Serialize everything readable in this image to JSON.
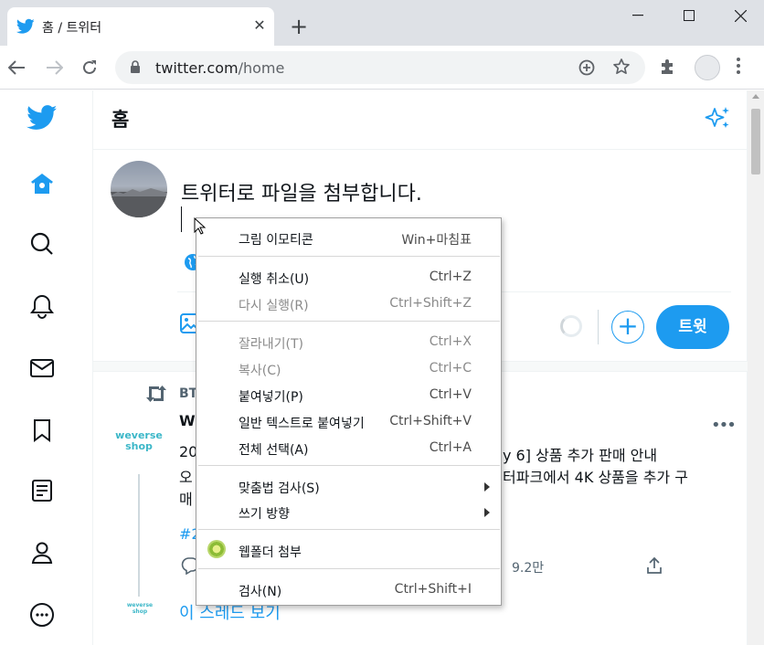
{
  "browser": {
    "tab_title": "홈 / 트위터",
    "url_host": "twitter.com",
    "url_path": "/home",
    "new_tab_symbol": "+",
    "tab_close_symbol": "✕",
    "icons": [
      "twitter-bird-icon",
      "close-icon",
      "plus-icon",
      "minimize-icon",
      "maximize-icon",
      "window-close-icon",
      "back-icon",
      "forward-icon",
      "reload-icon",
      "lock-icon",
      "add-circle-icon",
      "star-icon",
      "extensions-icon",
      "profile-icon",
      "kebab-menu-icon"
    ]
  },
  "nav": {
    "icons": [
      "twitter-logo-icon",
      "home-icon",
      "search-icon",
      "bell-icon",
      "mail-icon",
      "bookmark-icon",
      "list-icon",
      "profile-icon",
      "more-icon"
    ]
  },
  "header": {
    "title": "홈"
  },
  "composer": {
    "text": "트위터로 파일을 첨부합니다.",
    "tweet_button": "트윗",
    "plus_symbol": "+"
  },
  "tweet": {
    "retweet_label": "BT",
    "author_initial": "W",
    "logo_text": [
      "weverse",
      "shop"
    ],
    "lines_left": [
      "20",
      "오",
      "매"
    ],
    "line1_right": "y 6] 상품 추가 판매 안내",
    "line2_right": "터파크에서 4K 상품을 추가 구",
    "hashtag": "#2",
    "views": "9.2만",
    "more": "•••",
    "show_thread": "이 스레드 보기"
  },
  "context_menu": {
    "items": [
      {
        "label": "그림 이모티콘",
        "shortcut": "Win+마침표",
        "disabled": false
      },
      {
        "label": "실행 취소(U)",
        "shortcut": "Ctrl+Z",
        "disabled": false
      },
      {
        "label": "다시 실행(R)",
        "shortcut": "Ctrl+Shift+Z",
        "disabled": true
      },
      {
        "label": "잘라내기(T)",
        "shortcut": "Ctrl+X",
        "disabled": true
      },
      {
        "label": "복사(C)",
        "shortcut": "Ctrl+C",
        "disabled": true
      },
      {
        "label": "붙여넣기(P)",
        "shortcut": "Ctrl+V",
        "disabled": false
      },
      {
        "label": "일반 텍스트로 붙여넣기",
        "shortcut": "Ctrl+Shift+V",
        "disabled": false
      },
      {
        "label": "전체 선택(A)",
        "shortcut": "Ctrl+A",
        "disabled": false
      },
      {
        "label": "맞춤법 검사(S)",
        "shortcut": "",
        "disabled": false,
        "submenu": true
      },
      {
        "label": "쓰기 방향",
        "shortcut": "",
        "disabled": false,
        "submenu": true
      },
      {
        "label": "웹폴더 첨부",
        "shortcut": "",
        "disabled": false,
        "icon": "webfolder-icon"
      },
      {
        "label": "검사(N)",
        "shortcut": "Ctrl+Shift+I",
        "disabled": false
      }
    ]
  },
  "colors": {
    "twitter_blue": "#1d9bf0",
    "chrome_bg": "#dee1e6"
  }
}
